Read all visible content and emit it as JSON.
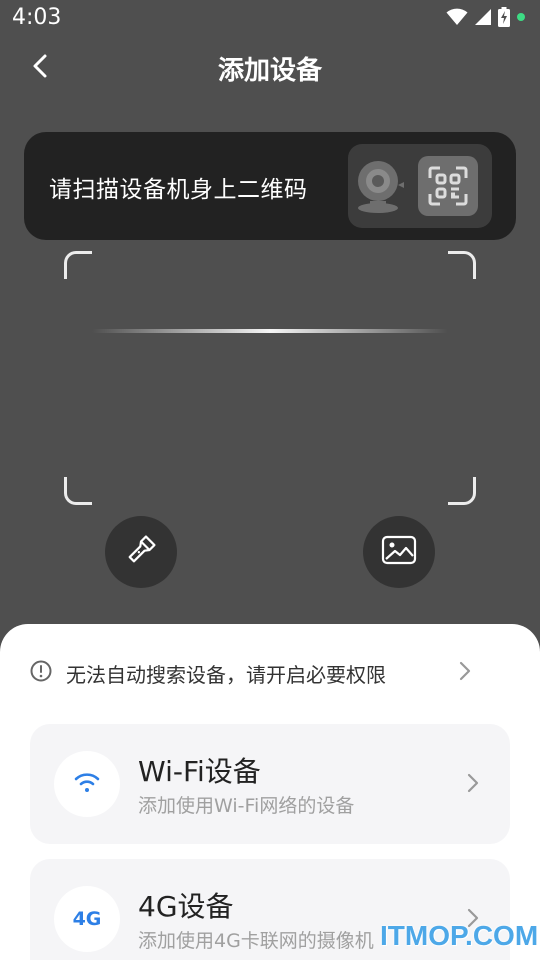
{
  "status_bar": {
    "time": "4:03",
    "icons": [
      "wifi-icon",
      "signal-icon",
      "battery-charging-icon",
      "notification-dot-icon"
    ],
    "dot_color": "#3ddc84"
  },
  "header": {
    "title": "添加设备",
    "back_icon": "chevron-left-icon"
  },
  "scan_hint": {
    "text": "请扫描设备机身上二维码",
    "illustration_icons": [
      "camera-icon",
      "qr-code-icon"
    ]
  },
  "scanner": {
    "flashlight_icon": "flashlight-icon",
    "album_icon": "image-icon"
  },
  "sheet": {
    "permission_notice": "无法自动搜索设备，请开启必要权限",
    "devices": [
      {
        "title": "Wi-Fi设备",
        "subtitle": "添加使用Wi-Fi网络的设备",
        "icon": "wifi-icon"
      },
      {
        "title": "4G设备",
        "subtitle": "添加使用4G卡联网的摄像机",
        "icon_text": "4G"
      }
    ]
  },
  "colors": {
    "background": "#4f4f4f",
    "card_dark": "#222222",
    "accent_blue": "#2d7fe6",
    "sheet": "#ffffff"
  },
  "watermark": "ITMOP.COM"
}
